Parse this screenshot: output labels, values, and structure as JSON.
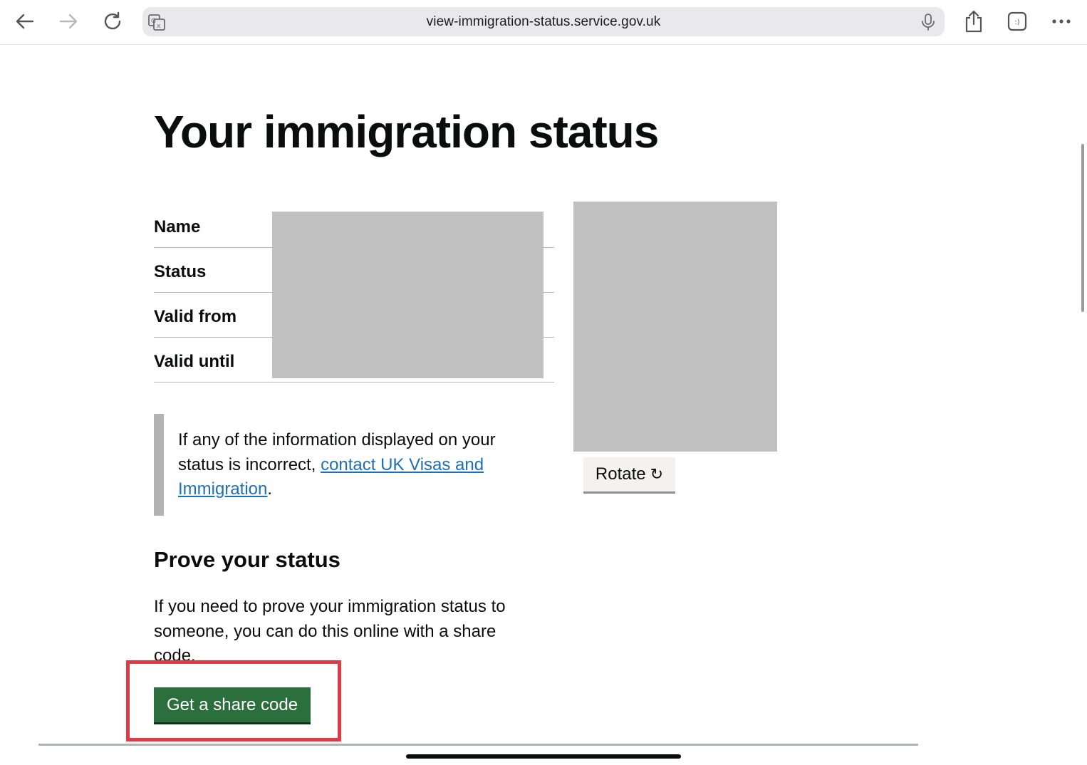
{
  "browser": {
    "url": "view-immigration-status.service.gov.uk",
    "icons": {
      "back": "arrow-left-icon",
      "forward": "arrow-right-icon",
      "reload": "reload-icon",
      "translate": "translate-icon",
      "mic": "microphone-icon",
      "share": "share-icon",
      "tabs": "tabs-icon",
      "more": "more-icon"
    },
    "tabs_badge": ":)",
    "more_label": "•••"
  },
  "page": {
    "title": "Your immigration status",
    "summary": [
      {
        "key": "Name"
      },
      {
        "key": "Status"
      },
      {
        "key": "Valid from"
      },
      {
        "key": "Valid until"
      }
    ],
    "rotate_button": {
      "label": "Rotate",
      "icon": "↻"
    },
    "inset": {
      "text_before": "If any of the information displayed on your status is incorrect, ",
      "link_text": "contact UK Visas and Immigration",
      "text_after": "."
    },
    "prove": {
      "heading": "Prove your status",
      "body": "If you need to prove your immigration status to someone, you can do this online with a share code.",
      "button": "Get a share code"
    }
  },
  "colors": {
    "link": "#1d70b8",
    "primary_button": "#2b6f3c",
    "highlight": "#dc3b45",
    "redaction": "#c1c1c1"
  }
}
